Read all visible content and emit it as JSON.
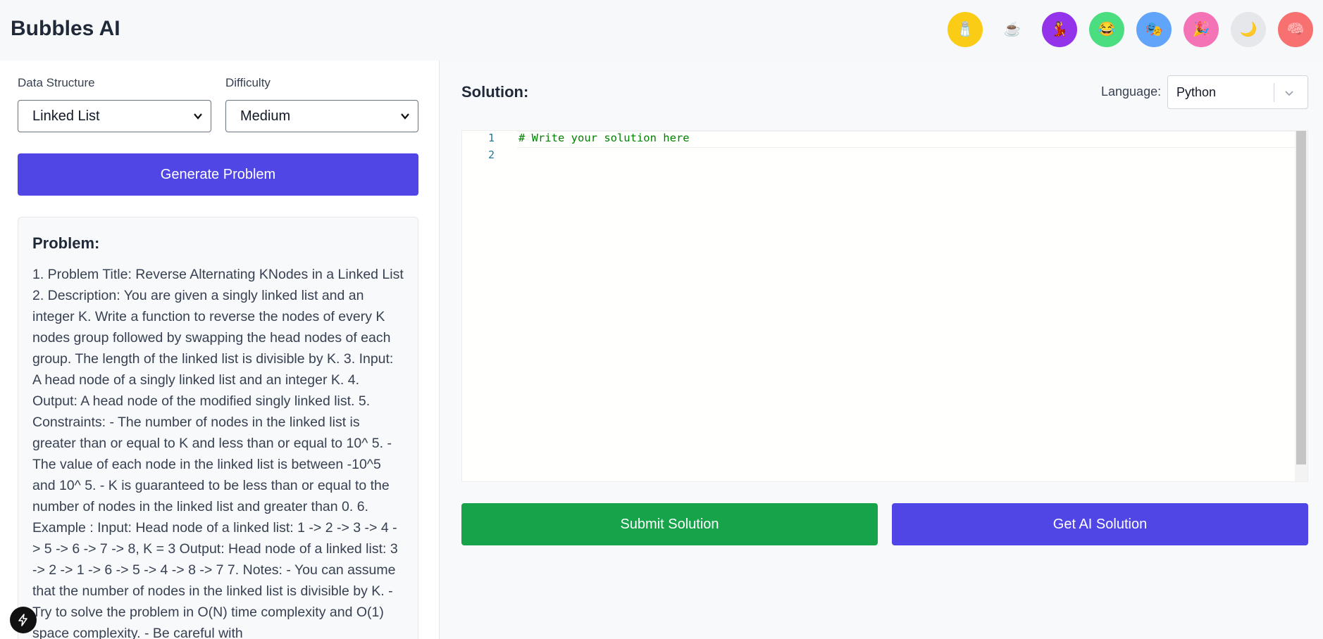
{
  "app": {
    "title": "Bubbles AI"
  },
  "avatars": [
    {
      "name": "avatar-shaker",
      "emoji": "🧂",
      "color": "#facc15"
    },
    {
      "name": "avatar-coffee",
      "emoji": "☕",
      "color": "#f7f8fa"
    },
    {
      "name": "avatar-dancer",
      "emoji": "💃",
      "color": "#9333ea"
    },
    {
      "name": "avatar-laugh",
      "emoji": "😂",
      "color": "#4ade80"
    },
    {
      "name": "avatar-masks",
      "emoji": "🎭",
      "color": "#60a5fa"
    },
    {
      "name": "avatar-party",
      "emoji": "🎉",
      "color": "#f472b6"
    },
    {
      "name": "avatar-moon",
      "emoji": "🌙",
      "color": "#e5e7eb"
    },
    {
      "name": "avatar-brain",
      "emoji": "🧠",
      "color": "#f87171"
    }
  ],
  "controls": {
    "data_structure_label": "Data Structure",
    "data_structure_value": "Linked List",
    "difficulty_label": "Difficulty",
    "difficulty_value": "Medium",
    "generate_button": "Generate Problem"
  },
  "problem": {
    "heading": "Problem:",
    "text": "1. Problem Title: Reverse Alternating KNodes in a Linked List 2. Description: You are given a singly linked list and an integer K. Write a function to reverse the nodes of every K nodes group followed by swapping the head nodes of each group. The length of the linked list is divisible by K. 3. Input: A head node of a singly linked list and an integer K. 4. Output: A head node of the modified singly linked list. 5. Constraints: - The number of nodes in the linked list is greater than or equal to K and less than or equal to 10^ 5. - The value of each node in the linked list is between -10^5 and 10^ 5. - K is guaranteed to be less than or equal to the number of nodes in the linked list and greater than 0. 6. Example : Input: Head node of a linked list: 1 -> 2 -> 3 -> 4 -> 5 -> 6 -> 7 -> 8, K = 3 Output: Head node of a linked list: 3 -> 2 -> 1 -> 6 -> 5 -> 4 -> 8 -> 7 7. Notes: - You can assume that the number of nodes in the linked list is divisible by K. - Try to solve the problem in O(N) time complexity and O(1) space complexity. - Be careful with"
  },
  "solution": {
    "heading": "Solution:",
    "language_label": "Language:",
    "language_value": "Python",
    "line_numbers": [
      "1",
      "2"
    ],
    "code_lines": [
      "# Write your solution here",
      ""
    ],
    "submit_button": "Submit Solution",
    "ai_button": "Get AI Solution"
  },
  "colors": {
    "accent": "#4f46e5",
    "submit": "#16a34a"
  }
}
